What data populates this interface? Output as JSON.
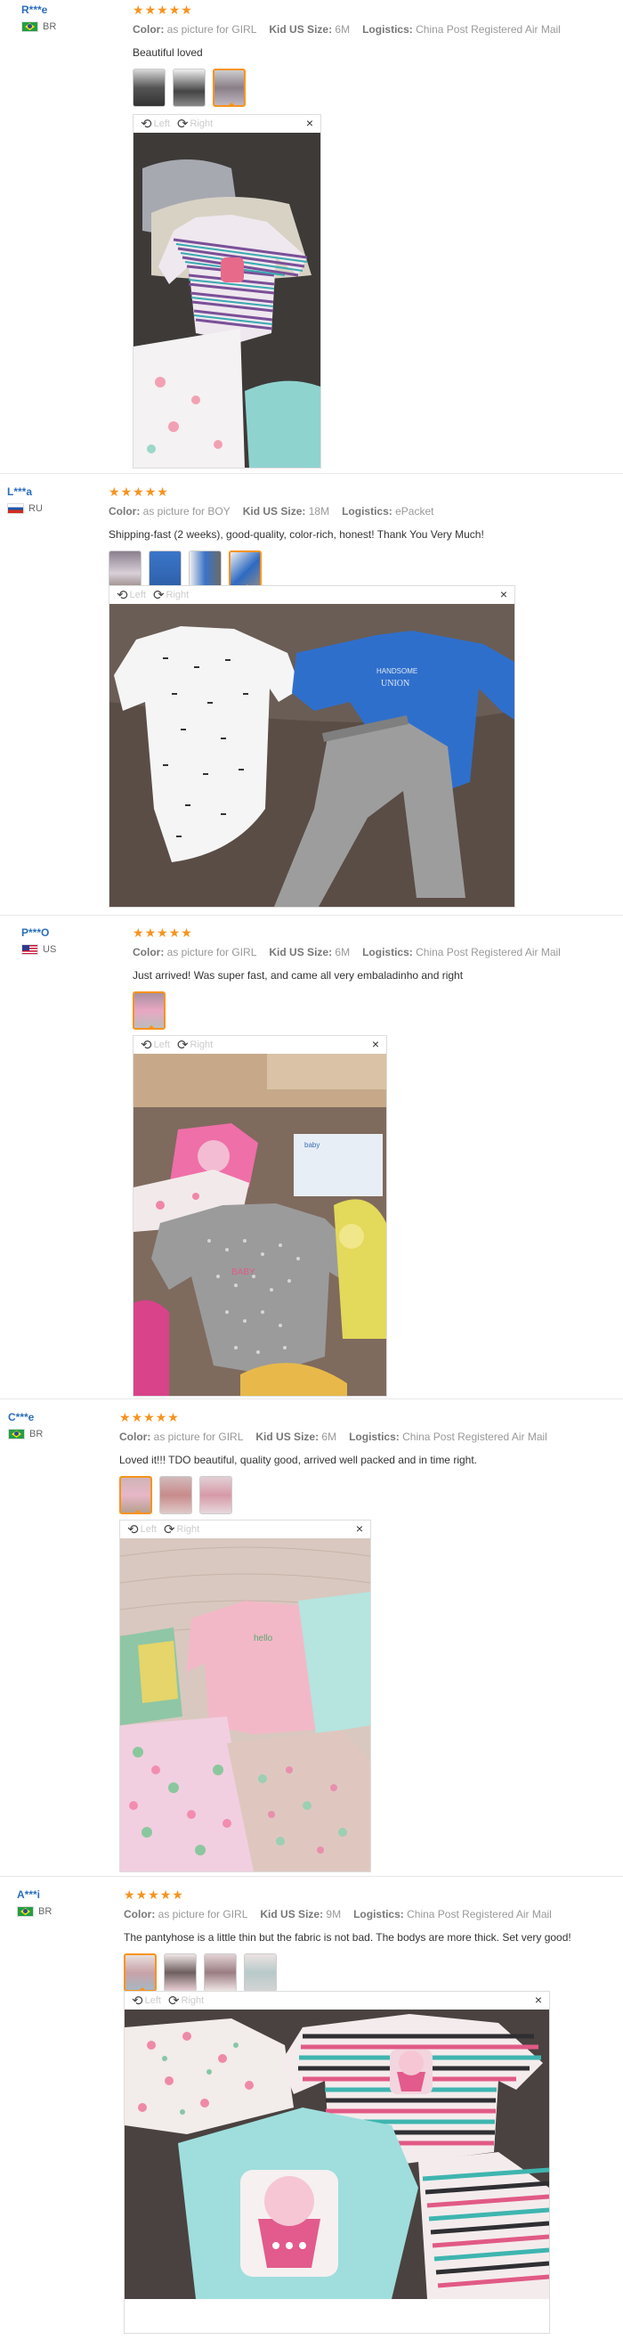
{
  "common": {
    "color_label": "Color:",
    "size_label": "Kid US Size:",
    "logistics_label": "Logistics:",
    "rotate_left": "Left",
    "rotate_right": "Right",
    "close": "×",
    "star": "★"
  },
  "reviews": [
    {
      "user": "R***e",
      "country": "BR",
      "rating": 5,
      "color": "as picture for GIRL",
      "size": "6M",
      "logistics": "China Post Registered Air Mail",
      "comment": "Beautiful loved",
      "thumbnail_count": 3,
      "active_thumbnail": 3
    },
    {
      "user": "L***a",
      "country": "RU",
      "rating": 5,
      "color": "as picture for BOY",
      "size": "18M",
      "logistics": "ePacket",
      "comment": "Shipping-fast (2 weeks), good-quality, color-rich, honest! Thank You Very Much!",
      "thumbnail_count": 4,
      "active_thumbnail": 4
    },
    {
      "user": "P***O",
      "country": "US",
      "rating": 5,
      "color": "as picture for GIRL",
      "size": "6M",
      "logistics": "China Post Registered Air Mail",
      "comment": "Just arrived! Was super fast, and came all very embaladinho and right",
      "thumbnail_count": 1,
      "active_thumbnail": 1
    },
    {
      "user": "C***e",
      "country": "BR",
      "rating": 5,
      "color": "as picture for GIRL",
      "size": "6M",
      "logistics": "China Post Registered Air Mail",
      "comment": "Loved it!!! TDO beautiful, quality good, arrived well packed and in time right.",
      "thumbnail_count": 3,
      "active_thumbnail": 1
    },
    {
      "user": "A***i",
      "country": "BR",
      "rating": 5,
      "color": "as picture for GIRL",
      "size": "9M",
      "logistics": "China Post Registered Air Mail",
      "comment": "The pantyhose is a little thin but the fabric is not bad. The bodys are more thick. Set very good!",
      "thumbnail_count": 4,
      "active_thumbnail": 1
    }
  ]
}
